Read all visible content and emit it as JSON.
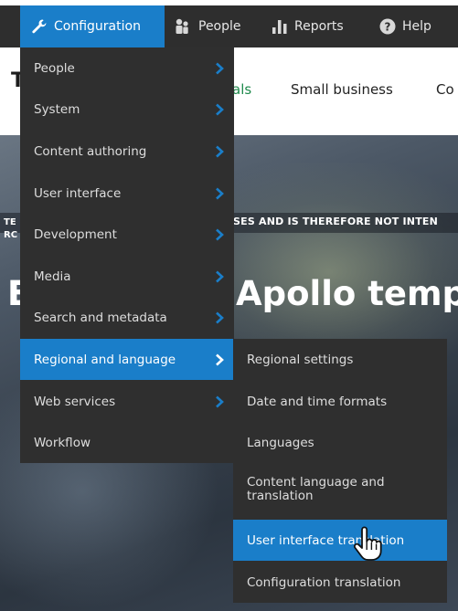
{
  "toolbar": {
    "items": [
      {
        "label": "Configuration",
        "icon": "wrench-icon"
      },
      {
        "label": "People",
        "icon": "people-icon"
      },
      {
        "label": "Reports",
        "icon": "bar-chart-icon"
      },
      {
        "label": "Help",
        "icon": "question-icon"
      }
    ]
  },
  "site": {
    "logo_fragment": "T",
    "nav": [
      "als",
      "Small business",
      "Co"
    ]
  },
  "hero": {
    "banner_text": "SES AND IS THEREFORE NOT INTEN",
    "left_fragment_1": "TE",
    "left_fragment_2": "RC",
    "title_left_fragment": "E",
    "title": "Apollo temp"
  },
  "menu": {
    "items": [
      {
        "label": "People",
        "has_submenu": true
      },
      {
        "label": "System",
        "has_submenu": true
      },
      {
        "label": "Content authoring",
        "has_submenu": true
      },
      {
        "label": "User interface",
        "has_submenu": true
      },
      {
        "label": "Development",
        "has_submenu": true
      },
      {
        "label": "Media",
        "has_submenu": true
      },
      {
        "label": "Search and metadata",
        "has_submenu": true
      },
      {
        "label": "Regional and language",
        "has_submenu": true,
        "active": true
      },
      {
        "label": "Web services",
        "has_submenu": true
      },
      {
        "label": "Workflow",
        "has_submenu": false
      }
    ]
  },
  "submenu": {
    "items": [
      {
        "label": "Regional settings"
      },
      {
        "label": "Date and time formats"
      },
      {
        "label": "Languages"
      },
      {
        "label": "Content language and translation"
      },
      {
        "label": "User interface translation",
        "active": true
      },
      {
        "label": "Configuration translation"
      }
    ]
  },
  "colors": {
    "toolbar_bg": "#2e2e2e",
    "menu_bg": "#2f2f2f",
    "accent_blue": "#1a7ec9",
    "nav_active_green": "#1f8a4c"
  }
}
